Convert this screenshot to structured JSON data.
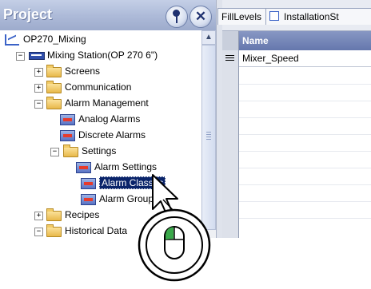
{
  "project_panel": {
    "title": "Project",
    "tree": [
      {
        "label": "OP270_Mixing",
        "icon": "project-icon",
        "level": 0,
        "expander": ""
      },
      {
        "label": "Mixing Station(OP 270 6\")",
        "icon": "station-icon",
        "level": 1,
        "expander": "−"
      },
      {
        "label": "Screens",
        "icon": "folder-icon",
        "level": 2,
        "expander": "+"
      },
      {
        "label": "Communication",
        "icon": "folder-icon",
        "level": 2,
        "expander": "+"
      },
      {
        "label": "Alarm Management",
        "icon": "folder-icon",
        "level": 2,
        "expander": "−"
      },
      {
        "label": "Analog Alarms",
        "icon": "alarm-icon",
        "level": 3,
        "expander": ""
      },
      {
        "label": "Discrete Alarms",
        "icon": "alarm-icon",
        "level": 3,
        "expander": ""
      },
      {
        "label": "Settings",
        "icon": "folder-icon",
        "level": 3,
        "expander": "−"
      },
      {
        "label": "Alarm Settings",
        "icon": "alarm-icon",
        "level": 4,
        "expander": ""
      },
      {
        "label": "Alarm Classes",
        "icon": "alarm-icon",
        "level": 4,
        "expander": "",
        "selected": true
      },
      {
        "label": "Alarm Groups",
        "icon": "alarm-icon",
        "level": 4,
        "expander": ""
      },
      {
        "label": "Recipes",
        "icon": "folder-icon",
        "level": 2,
        "expander": "+"
      },
      {
        "label": "Historical Data",
        "icon": "folder-icon",
        "level": 2,
        "expander": "−"
      }
    ],
    "scroll_up_glyph": "▲"
  },
  "editor": {
    "tabs": [
      {
        "label": "FillLevels"
      },
      {
        "label": "InstallationSt"
      }
    ],
    "column_header": "Name",
    "rows": [
      {
        "name": "Mixer_Speed"
      }
    ]
  },
  "colors": {
    "header_gradient": "#aebbd9",
    "selection": "#0a246a",
    "column_header": "#6577ad"
  }
}
